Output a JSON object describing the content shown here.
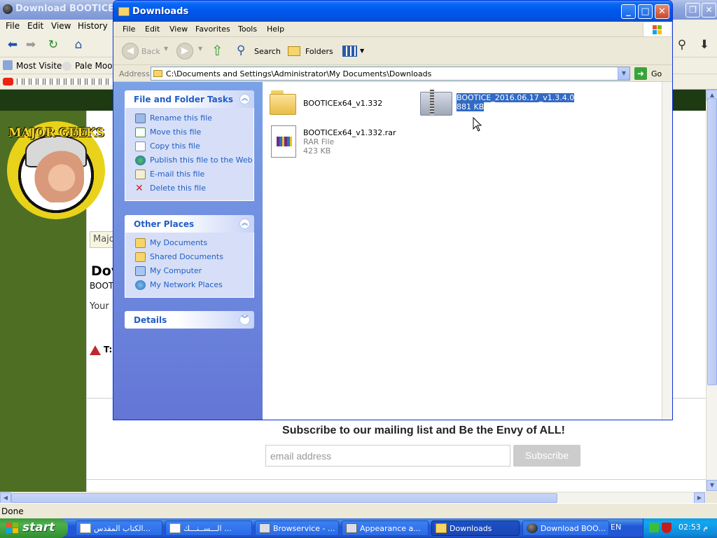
{
  "browser": {
    "title": "Download BOOTICE 32",
    "menu": [
      "File",
      "Edit",
      "View",
      "History"
    ],
    "bookmarks": [
      "Most Visited",
      "Pale Moon"
    ],
    "page": {
      "site_box_text": "Majo",
      "download_heading": "Dov",
      "download_sub": "BOOT",
      "your_text": "Your",
      "warning_text": "T:",
      "logo_text": "MAJOR GEEKS",
      "subscribe_text": "Subscribe to our mailing list and Be the Envy of ALL!",
      "email_placeholder": "email address",
      "subscribe_button": "Subscribe"
    },
    "status": "Done"
  },
  "explorer": {
    "title": "Downloads",
    "menu": [
      "File",
      "Edit",
      "View",
      "Favorites",
      "Tools",
      "Help"
    ],
    "toolbar": {
      "back": "Back",
      "search": "Search",
      "folders": "Folders"
    },
    "address_label": "Address",
    "address": "C:\\Documents and Settings\\Administrator\\My Documents\\Downloads",
    "go_label": "Go",
    "tasks": {
      "file_folder_title": "File and Folder Tasks",
      "file_folder_items": [
        "Rename this file",
        "Move this file",
        "Copy this file",
        "Publish this file to the Web",
        "E-mail this file",
        "Delete this file"
      ],
      "other_places_title": "Other Places",
      "other_places_items": [
        "My Documents",
        "Shared Documents",
        "My Computer",
        "My Network Places"
      ],
      "details_title": "Details"
    },
    "files": [
      {
        "name": "BOOTICEx64_v1.332",
        "type": "",
        "size": ""
      },
      {
        "name": "BOOTICE_2016.06.17_v1.3.4.0",
        "type": "",
        "size": "881 KB"
      },
      {
        "name": "BOOTICEx64_v1.332.rar",
        "type": "RAR File",
        "size": "423 KB"
      }
    ]
  },
  "taskbar": {
    "start": "start",
    "buttons": [
      "الكتاب المقدس...",
      "الـــســنـــك ...",
      "Browservice - ...",
      "Appearance a...",
      "Downloads",
      "Download BOO..."
    ],
    "language": "EN",
    "clock": "02:53 م"
  },
  "colors": {
    "xp_blue": "#0058ee",
    "selection": "#316ac5",
    "task_link": "#215dc6",
    "start_green": "#3c9a3c"
  }
}
